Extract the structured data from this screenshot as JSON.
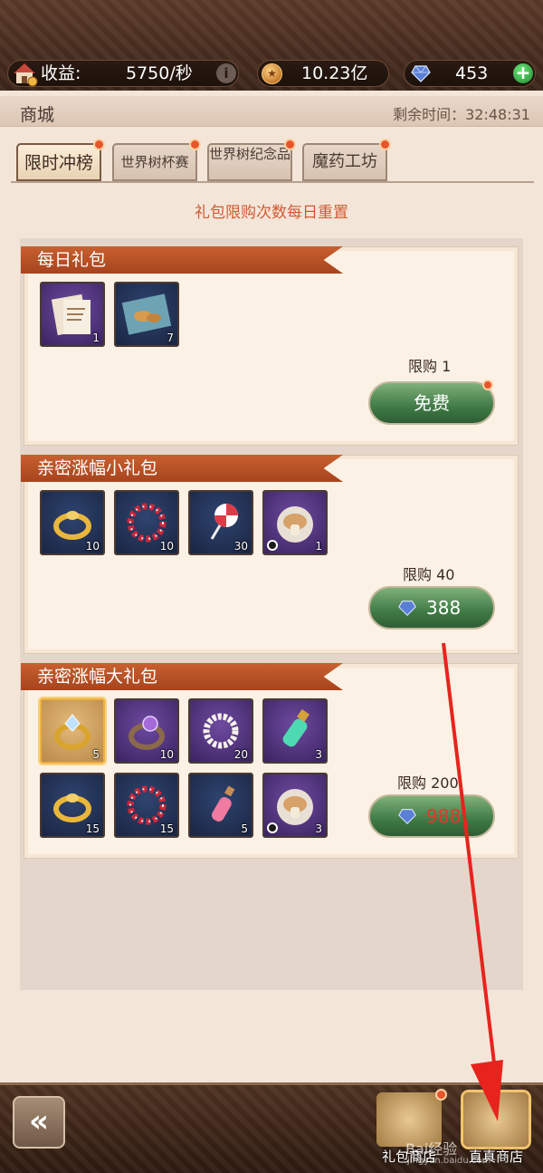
{
  "resources": {
    "income_label": "收益:",
    "income_value": "5750/秒",
    "gold_value": "10.23亿",
    "gem_value": "453"
  },
  "header": {
    "title": "商城",
    "timer": "剩余时间：32:48:31"
  },
  "tabs": [
    {
      "label": "限时冲榜",
      "active": true
    },
    {
      "label": "世界树杯赛",
      "active": false
    },
    {
      "label": "世界树纪念品",
      "active": false
    },
    {
      "label": "魔药工坊",
      "active": false
    }
  ],
  "notice": "礼包限购次数每日重置",
  "packs": [
    {
      "title": "每日礼包",
      "items": [
        {
          "name": "recipe-scroll-icon",
          "qty": "1"
        },
        {
          "name": "bread-plate-icon",
          "qty": "7"
        }
      ],
      "limit": "限购 1",
      "button": "免费"
    },
    {
      "title": "亲密涨幅小礼包",
      "items": [
        {
          "name": "gold-ring-icon",
          "qty": "10"
        },
        {
          "name": "flower-wreath-icon",
          "qty": "10"
        },
        {
          "name": "lollipop-icon",
          "qty": "30"
        },
        {
          "name": "mushroom-icon",
          "qty": "1"
        }
      ],
      "limit": "限购 40",
      "price": "388"
    },
    {
      "title": "亲密涨幅大礼包",
      "items": [
        {
          "name": "diamond-ring-icon",
          "qty": "5"
        },
        {
          "name": "amethyst-ring-icon",
          "qty": "10"
        },
        {
          "name": "pearl-necklace-icon",
          "qty": "20"
        },
        {
          "name": "potion-vial-icon",
          "qty": "3"
        },
        {
          "name": "gold-ring-icon",
          "qty": "15"
        },
        {
          "name": "flower-wreath-icon",
          "qty": "15"
        },
        {
          "name": "perfume-bottle-icon",
          "qty": "5"
        },
        {
          "name": "mushroom-icon",
          "qty": "3"
        }
      ],
      "limit": "限购 200",
      "price": "988"
    }
  ],
  "bottom_nav": {
    "gift_shop_label": "礼包商店",
    "cash_shop_label": "直真商店"
  },
  "watermark": {
    "text": "Bai经验",
    "sub": "jingyan.baidu.com"
  },
  "colors": {
    "accent_orange": "#c8602f",
    "buy_green": "#3f7a45",
    "annotation_red": "#e8231d"
  }
}
